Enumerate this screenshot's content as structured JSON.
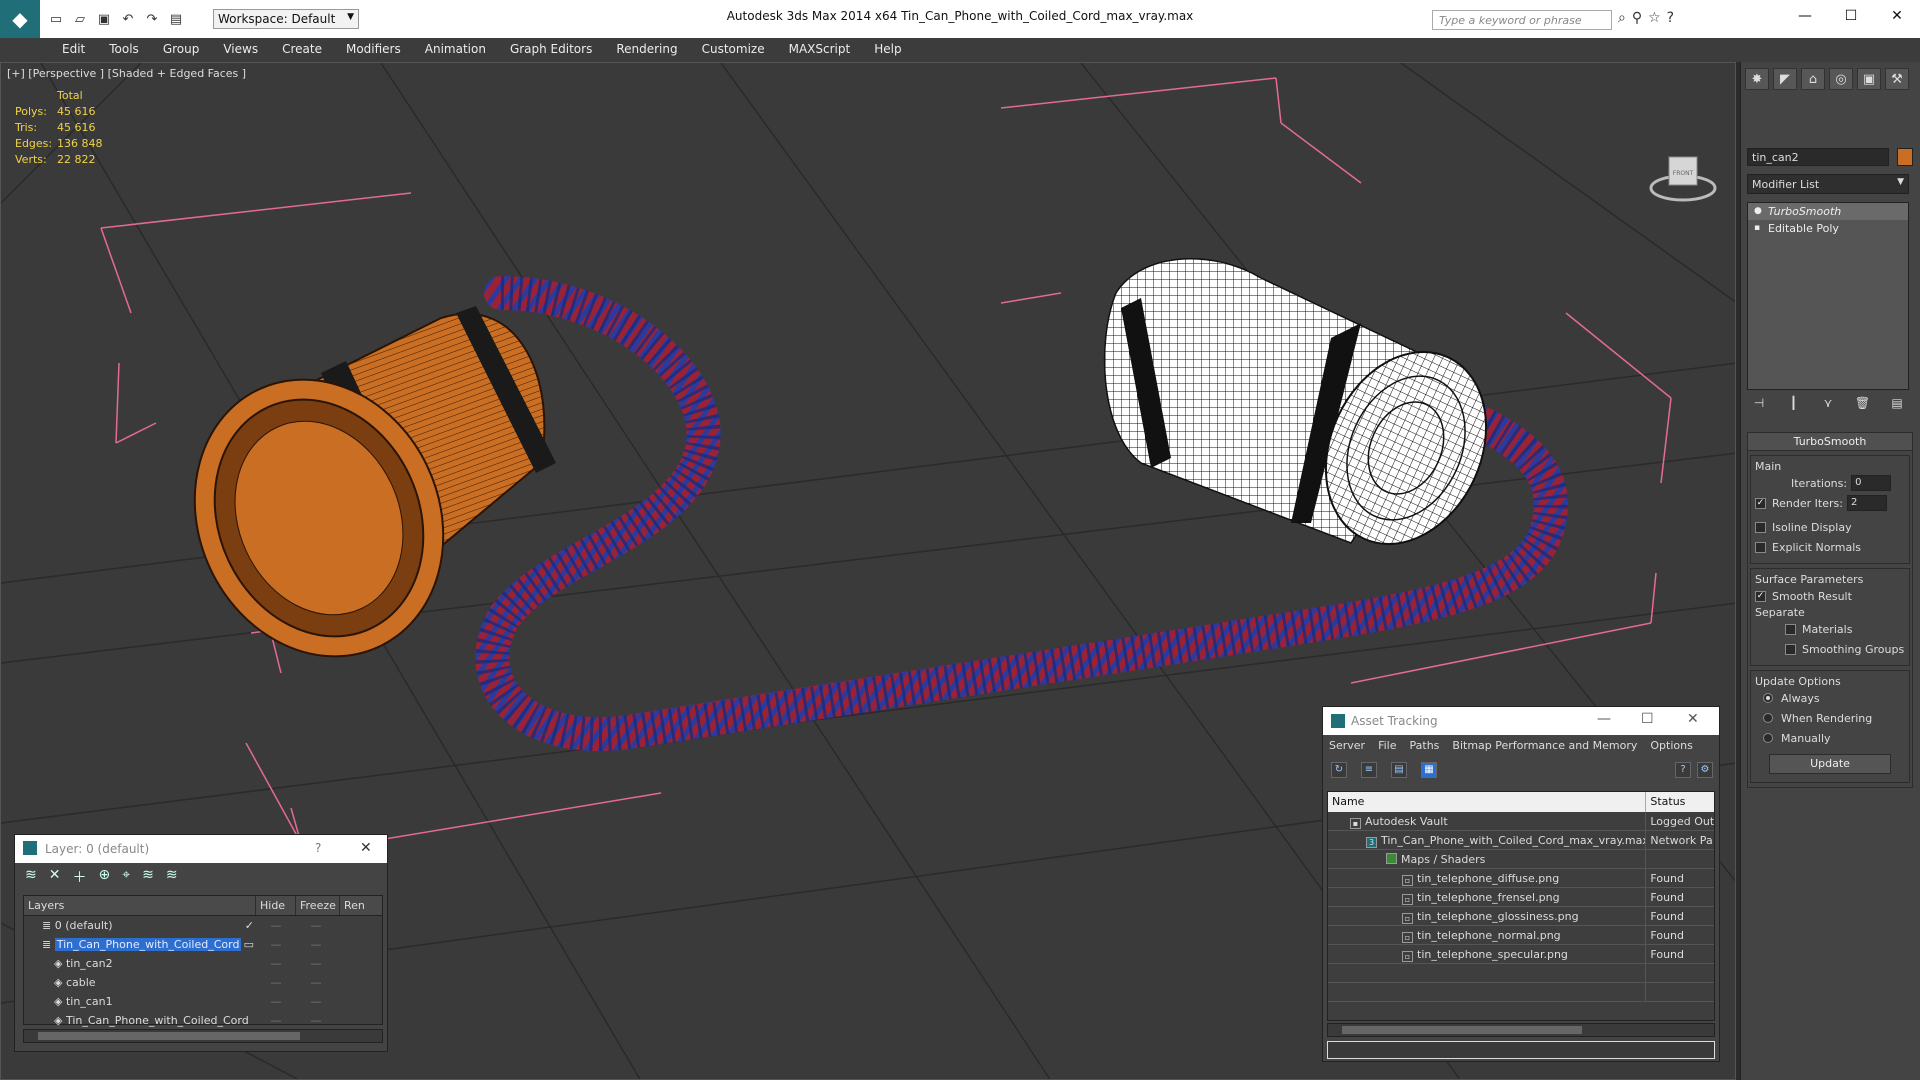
{
  "app": {
    "title": "Autodesk 3ds Max  2014 x64      Tin_Can_Phone_with_Coiled_Cord_max_vray.max",
    "workspace": "Workspace: Default",
    "search_placeholder": "Type a keyword or phrase"
  },
  "menu": [
    "Edit",
    "Tools",
    "Group",
    "Views",
    "Create",
    "Modifiers",
    "Animation",
    "Graph Editors",
    "Rendering",
    "Customize",
    "MAXScript",
    "Help"
  ],
  "viewport": {
    "label": "[+] [Perspective ] [Shaded + Edged Faces ]",
    "stats": {
      "header": "Total",
      "rows": [
        {
          "k": "Polys:",
          "v": "45 616"
        },
        {
          "k": "Tris:",
          "v": "45 616"
        },
        {
          "k": "Edges:",
          "v": "136 848"
        },
        {
          "k": "Verts:",
          "v": "22 822"
        }
      ]
    },
    "viewcube_label": "FRONT"
  },
  "command_panel": {
    "object_name": "tin_can2",
    "object_color": "#c96e22",
    "modifier_list": "Modifier List",
    "stack": [
      "TurboSmooth",
      "Editable Poly"
    ],
    "turbosmooth": {
      "title": "TurboSmooth",
      "main": "Main",
      "iterations_label": "Iterations:",
      "iterations": "0",
      "render_iters_label": "Render Iters:",
      "render_iters": "2",
      "isoline": "Isoline Display",
      "explicit": "Explicit Normals",
      "surface_params": "Surface Parameters",
      "smooth_result": "Smooth Result",
      "separate": "Separate",
      "materials": "Materials",
      "smoothing_groups": "Smoothing Groups",
      "update_options": "Update Options",
      "always": "Always",
      "when_rendering": "When Rendering",
      "manually": "Manually",
      "update_button": "Update"
    }
  },
  "layers": {
    "title": "Layer: 0 (default)",
    "help": "?",
    "columns": [
      "Layers",
      "Hide",
      "Freeze",
      "Ren"
    ],
    "rows": [
      {
        "name": "0 (default)",
        "indent": 1,
        "selected": false
      },
      {
        "name": "Tin_Can_Phone_with_Coiled_Cord",
        "indent": 1,
        "selected": true
      },
      {
        "name": "tin_can2",
        "indent": 2,
        "selected": false
      },
      {
        "name": "cable",
        "indent": 2,
        "selected": false
      },
      {
        "name": "tin_can1",
        "indent": 2,
        "selected": false
      },
      {
        "name": "Tin_Can_Phone_with_Coiled_Cord",
        "indent": 2,
        "selected": false
      }
    ]
  },
  "asset_tracking": {
    "title": "Asset Tracking",
    "menu": [
      "Server",
      "File",
      "Paths",
      "Bitmap Performance and Memory",
      "Options"
    ],
    "columns": [
      "Name",
      "Status"
    ],
    "rows": [
      {
        "name": "Autodesk Vault",
        "status": "Logged Out",
        "indent": 1
      },
      {
        "name": "Tin_Can_Phone_with_Coiled_Cord_max_vray.max",
        "status": "Network Pa",
        "indent": 2
      },
      {
        "name": "Maps / Shaders",
        "status": "",
        "indent": 3
      },
      {
        "name": "tin_telephone_diffuse.png",
        "status": "Found",
        "indent": 4
      },
      {
        "name": "tin_telephone_frensel.png",
        "status": "Found",
        "indent": 4
      },
      {
        "name": "tin_telephone_glossiness.png",
        "status": "Found",
        "indent": 4
      },
      {
        "name": "tin_telephone_normal.png",
        "status": "Found",
        "indent": 4
      },
      {
        "name": "tin_telephone_specular.png",
        "status": "Found",
        "indent": 4
      }
    ]
  }
}
